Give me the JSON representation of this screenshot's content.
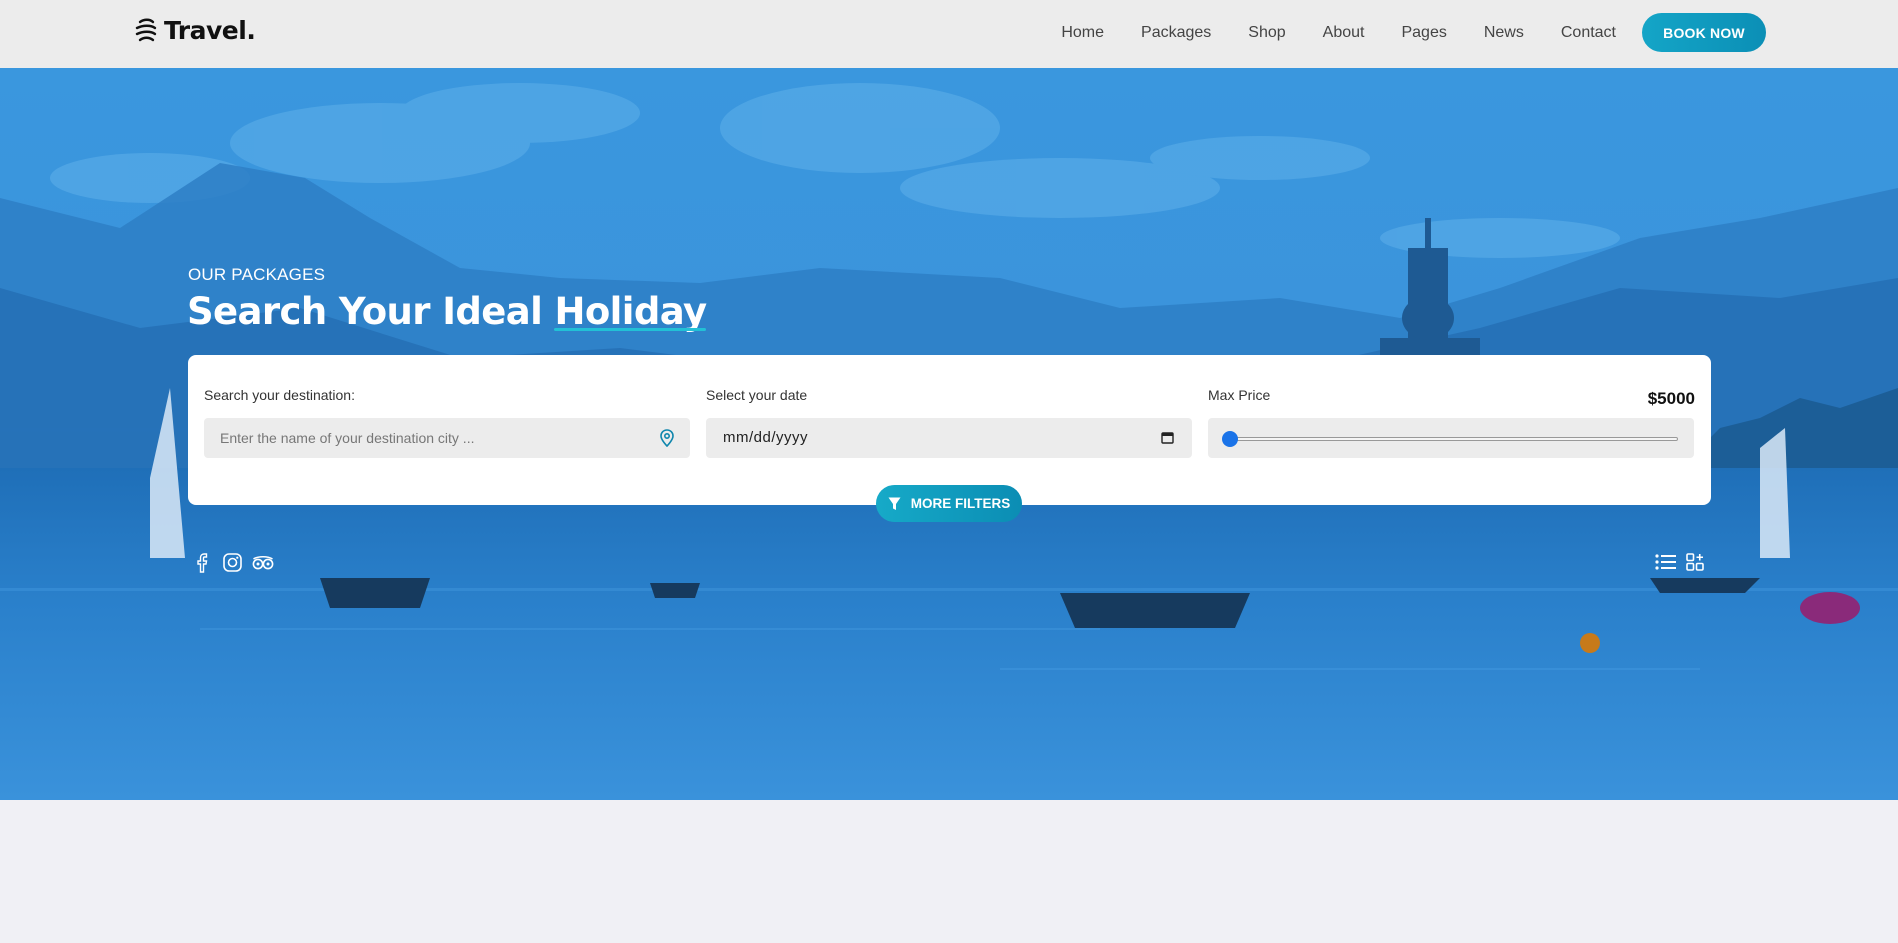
{
  "header": {
    "brand": "Travel.",
    "nav": [
      "Home",
      "Packages",
      "Shop",
      "About",
      "Pages",
      "News",
      "Contact"
    ],
    "cta": "BOOK NOW"
  },
  "hero": {
    "kicker": "OUR PACKAGES",
    "title_start": "Search Your Ideal ",
    "title_highlight": "Holiday"
  },
  "search": {
    "destination_label": "Search your destination:",
    "destination_placeholder": "Enter the name of your destination city ...",
    "date_label": "Select your date",
    "date_value": "mm/dd/yyyy",
    "price_label": "Max Price",
    "price_value": "$5000",
    "price_slider_fraction": 0.0
  },
  "filters_button": "MORE FILTERS",
  "icons": {
    "social": [
      "facebook-icon",
      "instagram-icon",
      "tripadvisor-icon"
    ],
    "views": [
      "list-view-icon",
      "grid-view-icon"
    ]
  },
  "colors": {
    "accent": "#14a5c7",
    "hero_blue": "#3a97de",
    "slider_thumb": "#1a73e8"
  }
}
